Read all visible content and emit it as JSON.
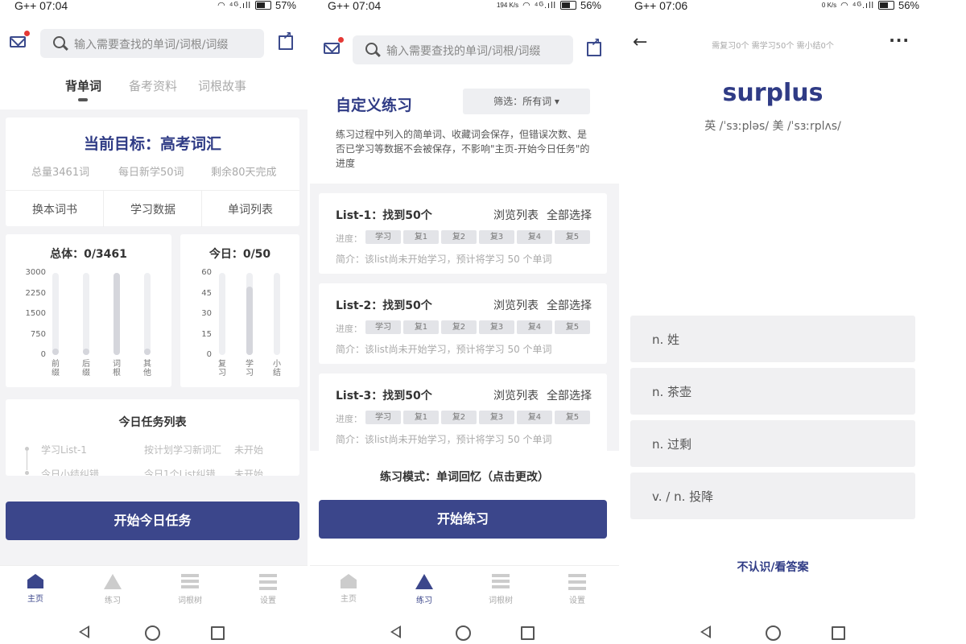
{
  "screen1": {
    "status": {
      "time": "G++ 07:04",
      "battery": "57%"
    },
    "search_placeholder": "输入需要查找的单词/词根/词缀",
    "tabs": [
      "背单词",
      "备考资料",
      "词根故事"
    ],
    "goal": {
      "title": "当前目标：高考词汇",
      "total": "总量3461词",
      "daily": "每日新学50词",
      "remaining": "剩余80天完成",
      "actions": [
        "换本词书",
        "学习数据",
        "单词列表"
      ]
    },
    "overall_chart": {
      "title": "总体：0/3461",
      "yticks": [
        "3000",
        "2250",
        "1500",
        "750",
        "0"
      ]
    },
    "today_chart": {
      "title": "今日：0/50",
      "yticks": [
        "60",
        "45",
        "30",
        "15",
        "0"
      ]
    },
    "tasks": {
      "title": "今日任务列表",
      "rows": [
        {
          "name": "学习List-1",
          "desc": "按计划学习新词汇",
          "status": "未开始"
        },
        {
          "name": "今日小结纠错",
          "desc": "今日1个List纠错",
          "status": "未开始"
        }
      ]
    },
    "start_button": "开始今日任务",
    "nav": [
      "主页",
      "练习",
      "词根树",
      "设置"
    ]
  },
  "screen2": {
    "status": {
      "time": "G++ 07:04",
      "speed": "194 K/s",
      "battery": "56%"
    },
    "search_placeholder": "输入需要查找的单词/词根/词缀",
    "title": "自定义练习",
    "filter": "筛选：所有词 ▾",
    "description": "练习过程中列入的简单词、收藏词会保存，但错误次数、是否已学习等数据不会被保存，不影响\"主页-开始今日任务\"的进度",
    "lists": [
      {
        "title": "List-1：找到50个",
        "browse": "浏览列表",
        "select_all": "全部选择",
        "progress_label": "进度：",
        "intro": "简介：该list尚未开始学习，预计将学习 50 个单词"
      },
      {
        "title": "List-2：找到50个",
        "browse": "浏览列表",
        "select_all": "全部选择",
        "progress_label": "进度：",
        "intro": "简介：该list尚未开始学习，预计将学习 50 个单词"
      },
      {
        "title": "List-3：找到50个",
        "browse": "浏览列表",
        "select_all": "全部选择",
        "progress_label": "进度：",
        "intro": "简介：该list尚未开始学习，预计将学习 50 个单词"
      }
    ],
    "chips": [
      "学习",
      "复1",
      "复2",
      "复3",
      "复4",
      "复5"
    ],
    "mode": "练习模式：单词回忆（点击更改）",
    "start_button": "开始练习",
    "nav": [
      "主页",
      "练习",
      "词根树",
      "设置"
    ]
  },
  "screen3": {
    "status": {
      "time": "G++ 07:06",
      "speed": "0 K/s",
      "battery": "56%"
    },
    "counts": "需复习0个  需学习50个  需小结0个",
    "word": "surplus",
    "phonetic": "英 /ˈsɜːpləs/    美 /ˈsɜːrplʌs/",
    "options": [
      "n. 姓",
      "n. 茶壶",
      "n. 过剩",
      "v. / n. 投降"
    ],
    "unknown": "不认识/看答案"
  },
  "chart_data": [
    {
      "type": "bar",
      "title": "总体：0/3461",
      "categories": [
        "前缀",
        "后缀",
        "词根",
        "其他"
      ],
      "values": [
        120,
        120,
        3000,
        120
      ],
      "ylim": [
        0,
        3000
      ]
    },
    {
      "type": "bar",
      "title": "今日：0/50",
      "categories": [
        "复习",
        "学习",
        "小结"
      ],
      "values": [
        0,
        50,
        0
      ],
      "ylim": [
        0,
        60
      ]
    }
  ],
  "colors": {
    "brand": "#3b468b",
    "alert_dot": "#e53935"
  }
}
